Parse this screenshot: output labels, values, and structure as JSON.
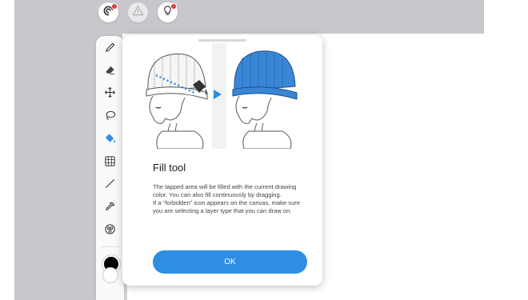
{
  "topbar": {
    "buttons": [
      {
        "icon": "swirl-logo-icon",
        "has_badge": true
      },
      {
        "icon": "warning-triangle-icon",
        "has_badge": false
      },
      {
        "icon": "lightbulb-icon",
        "has_badge": true
      }
    ]
  },
  "toolbar": {
    "tools": [
      "pen-icon",
      "eraser-icon",
      "move-icon",
      "lasso-icon",
      "fill-bucket-icon",
      "grid-transform-icon",
      "line-icon",
      "eyedropper-icon",
      "layers-palette-icon"
    ],
    "active_tool": "fill-bucket-icon",
    "colors": {
      "primary": "#000000",
      "secondary": "#ffffff",
      "accent": "#2d8ee3"
    }
  },
  "dialog": {
    "title": "Fill tool",
    "body": [
      "The tapped area will be filled with the current drawing color. You can also fill continuously by dragging.",
      "If a “forbidden” icon appears on the canvas, make sure you are selecting a layer type that you can draw on."
    ],
    "ok_label": "OK",
    "illustration": {
      "before": "line-art-beanie",
      "after": "blue-filled-beanie",
      "fill_color": "#3a86d6"
    }
  }
}
